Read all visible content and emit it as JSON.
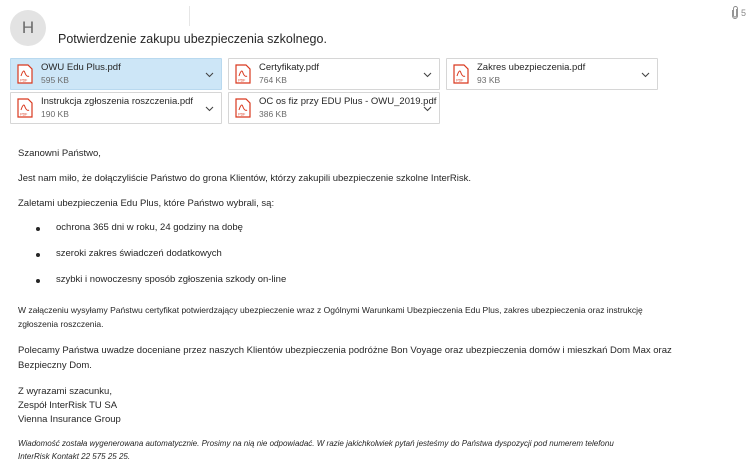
{
  "email": {
    "sender_initial": "H",
    "subject": "Potwierdzenie zakupu ubezpieczenia szkolnego.",
    "attachment_count": "5"
  },
  "attachments": [
    {
      "name": "OWU Edu Plus.pdf",
      "size": "595 KB"
    },
    {
      "name": "Certyfikaty.pdf",
      "size": "764 KB"
    },
    {
      "name": "Zakres ubezpieczenia.pdf",
      "size": "93 KB"
    },
    {
      "name": "Instrukcja zgłoszenia roszczenia.pdf",
      "size": "190 KB"
    },
    {
      "name": "OC os fiz przy EDU Plus - OWU_2019.pdf",
      "size": "386 KB"
    }
  ],
  "body": {
    "greeting": "Szanowni Państwo,",
    "intro": "Jest nam miło, że dołączyliście Państwo do grona Klientów, którzy zakupili ubezpieczenie szkolne InterRisk.",
    "lead": "Zaletami ubezpieczenia Edu Plus, które Państwo wybrali, są:",
    "bullets": [
      "ochrona 365 dni w roku, 24 godziny na dobę",
      "szeroki zakres świadczeń dodatkowych",
      "szybki i nowoczesny sposób zgłoszenia szkody on-line"
    ],
    "attachment_note_line1": "W załączeniu wysyłamy Państwu certyfikat potwierdzający ubezpieczenie wraz z Ogólnymi Warunkami Ubezpieczenia Edu Plus, zakres ubezpieczenia oraz instrukcję",
    "attachment_note_line2": "zgłoszenia roszczenia.",
    "recommend_line1": "Polecamy Państwa uwadze doceniane przez naszych Klientów ubezpieczenia podróżne Bon Voyage oraz ubezpieczenia domów i mieszkań Dom Max oraz",
    "recommend_line2": "Bezpieczny Dom.",
    "closing": "Z wyrazami szacunku,",
    "signature_line1": "Zespół InterRisk TU SA",
    "signature_line2": "Vienna Insurance Group",
    "auto_note_line1": "Wiadomość została wygenerowana automatycznie. Prosimy na nią nie odpowiadać. W razie jakichkolwiek pytań jesteśmy do Państwa dyspozycji pod numerem telefonu",
    "auto_note_line2": "InterRisk Kontakt 22 575 25 25."
  },
  "colors": {
    "selected_attachment_bg": "#cde6f7",
    "pdf_icon": "#d9381e"
  }
}
